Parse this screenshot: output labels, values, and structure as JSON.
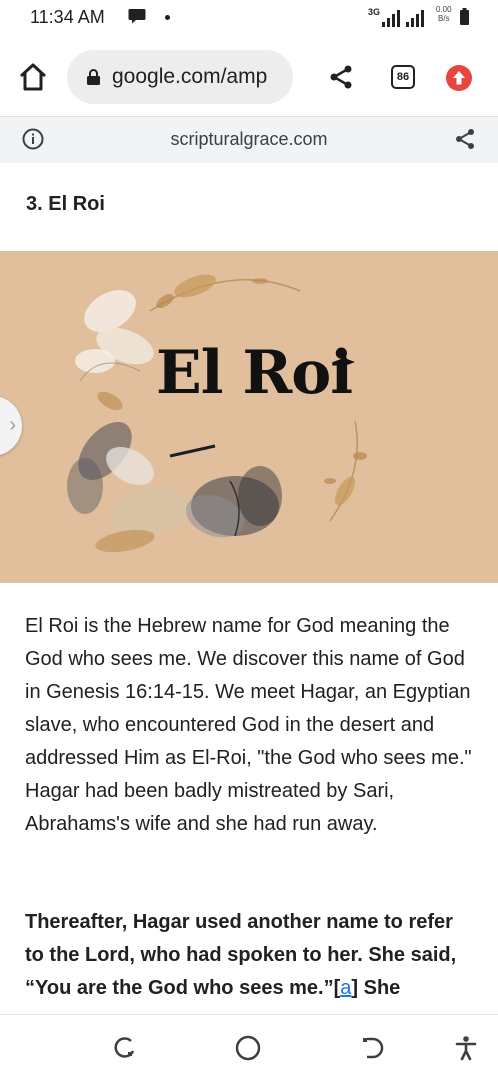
{
  "status_bar": {
    "time": "11:34 AM",
    "network": "3G",
    "speed_value": "0.00",
    "speed_unit": "B/s"
  },
  "toolbar": {
    "url": "google.com/amp",
    "tab_count": "86"
  },
  "amp_bar": {
    "domain": "scripturalgrace.com"
  },
  "article": {
    "heading": "3. El Roi",
    "hero_title": "El Roi",
    "paragraph_1": "El Roi is the Hebrew name for God meaning the God who sees me. We discover this name of God in Genesis 16:14-15. We meet Hagar, an Egyptian slave, who encountered God in the desert and addressed Him as El-Roi, \"the God who sees me.\"",
    "paragraph_2": "Hagar had been badly mistreated by Sari, Abrahams's wife and she had run away.",
    "bold_before": "Thereafter, Hagar used another name to refer to the Lord, who had spoken to her. She said, “You are the God who sees me.”[",
    "footnote_link": "a",
    "bold_after": "] She"
  },
  "colors": {
    "hero_background": "#e1bf9c",
    "update_button": "#e8453c",
    "link": "#1a73e8"
  }
}
